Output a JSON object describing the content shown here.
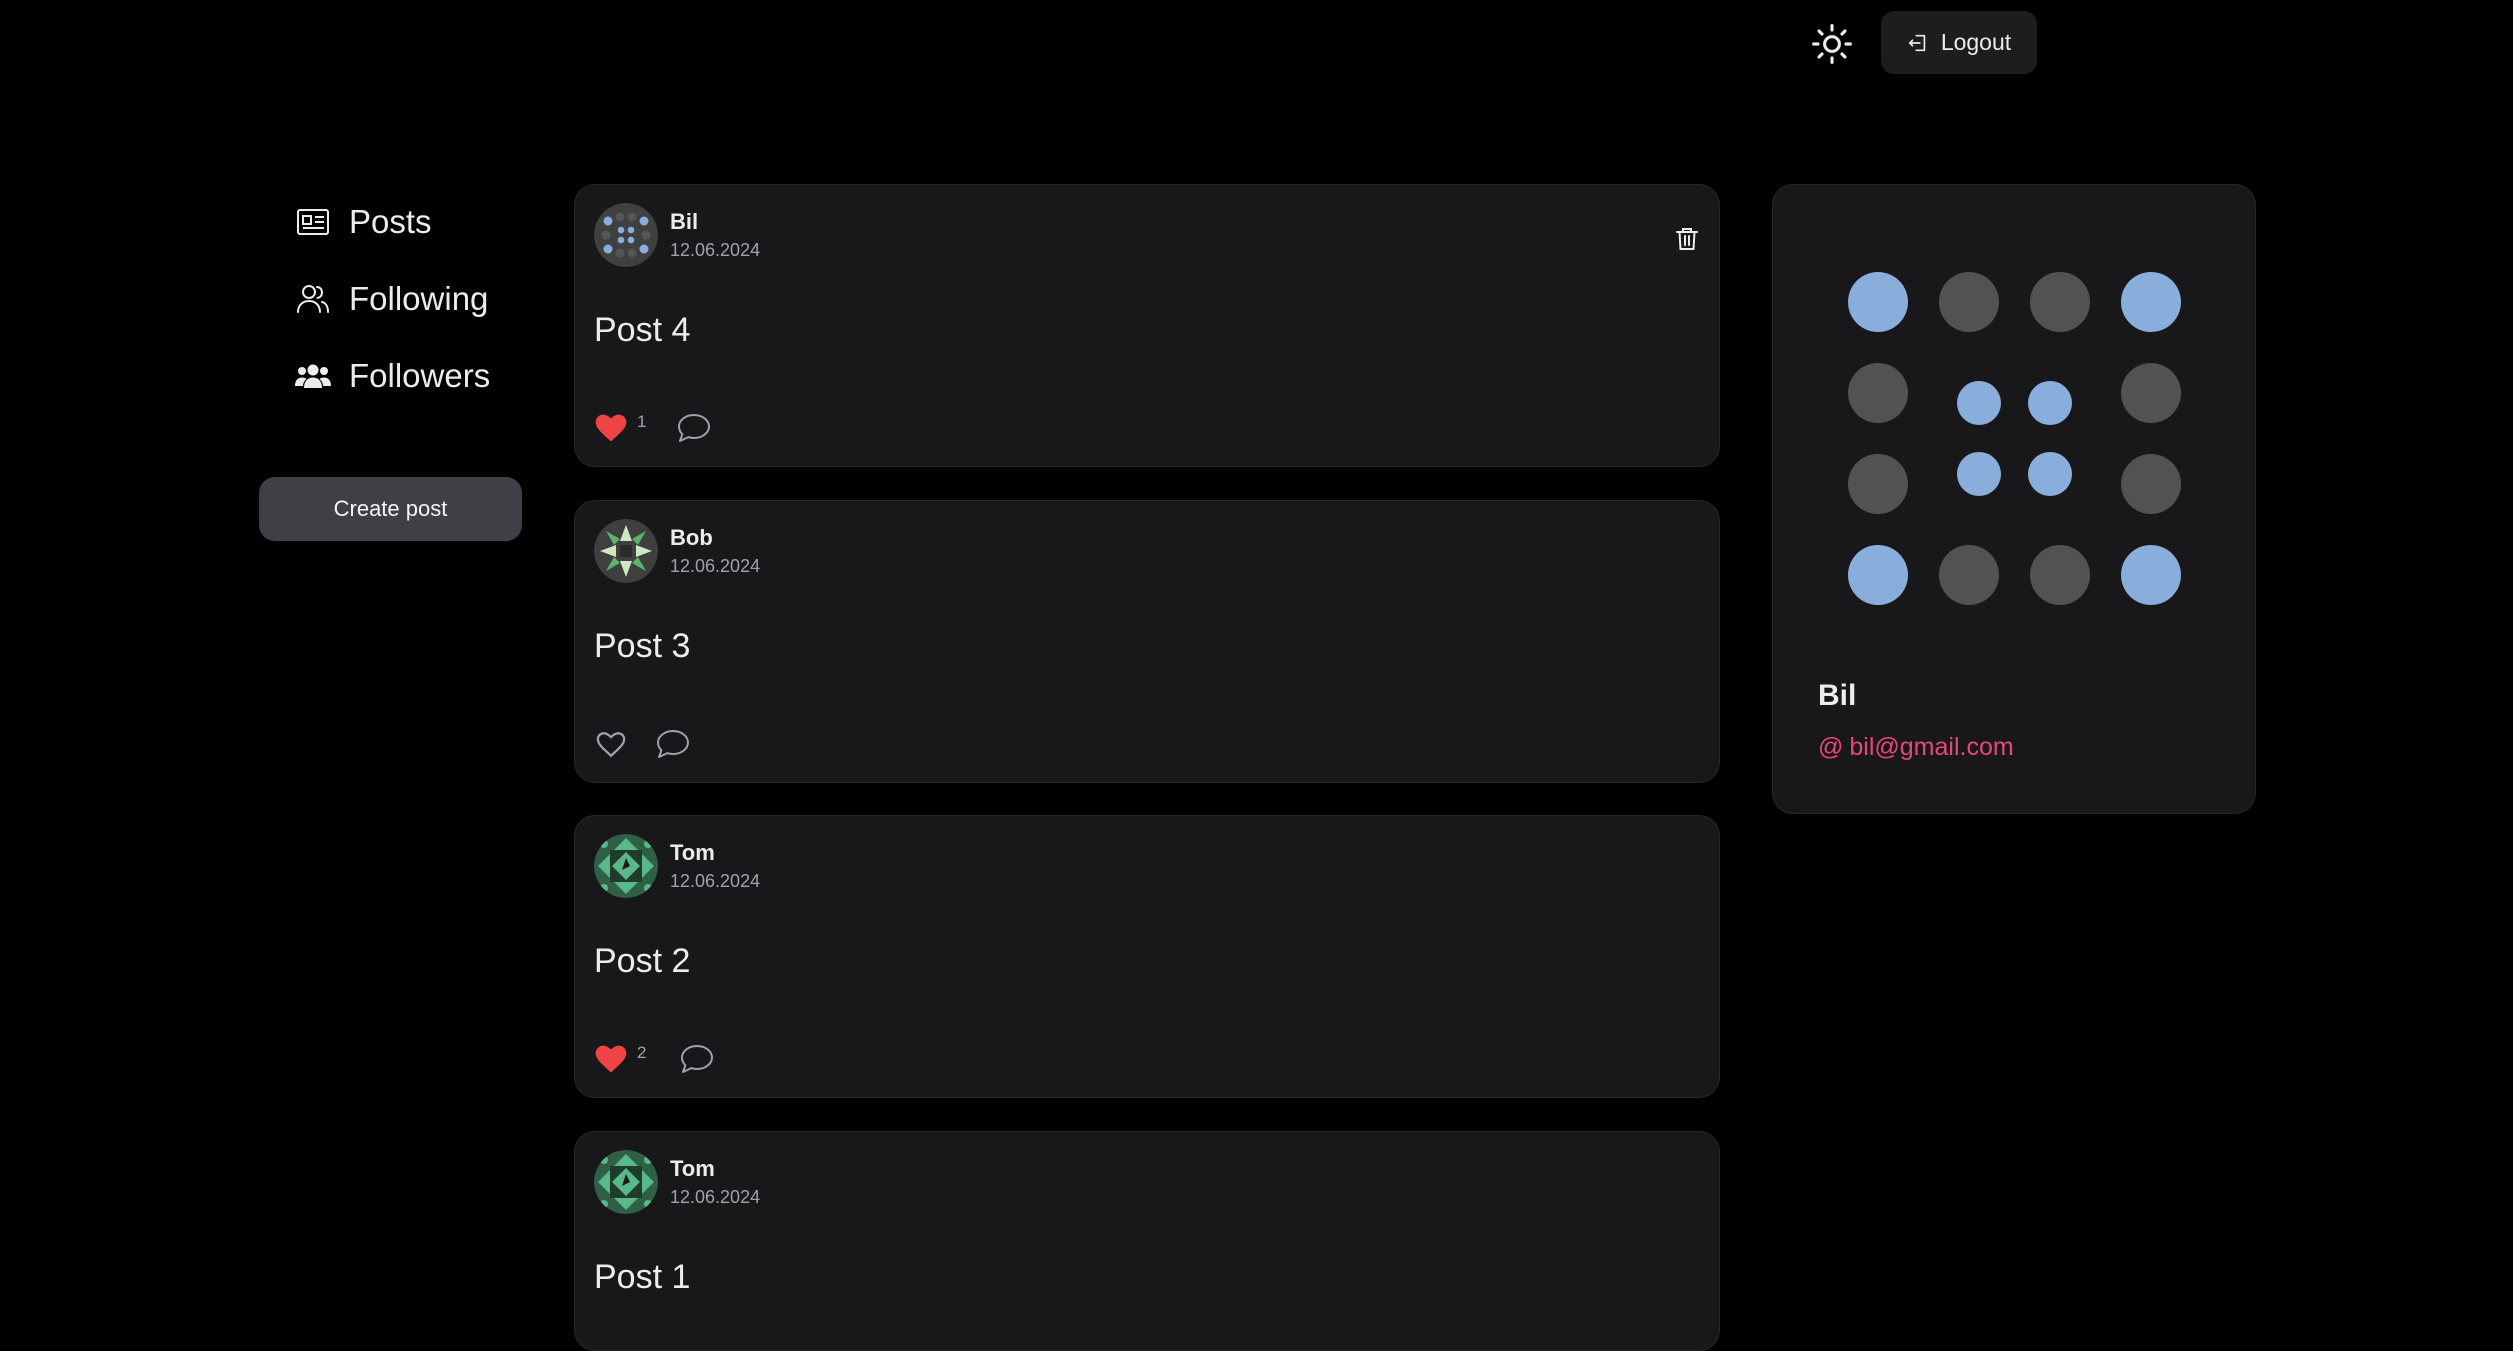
{
  "header": {
    "theme_icon": "sun-icon",
    "logout_label": "Logout",
    "logout_icon": "logout-icon"
  },
  "sidebar": {
    "items": [
      {
        "label": "Posts",
        "icon": "posts-icon"
      },
      {
        "label": "Following",
        "icon": "users-icon"
      },
      {
        "label": "Followers",
        "icon": "group-icon"
      }
    ],
    "create_post_label": "Create post"
  },
  "posts": [
    {
      "author": "Bil",
      "date": "12.06.2024",
      "content": "Post 4",
      "liked": true,
      "likes": "1",
      "deletable": true
    },
    {
      "author": "Bob",
      "date": "12.06.2024",
      "content": "Post 3",
      "liked": false,
      "likes": "",
      "deletable": false
    },
    {
      "author": "Tom",
      "date": "12.06.2024",
      "content": "Post 2",
      "liked": true,
      "likes": "2",
      "deletable": false
    },
    {
      "author": "Tom",
      "date": "12.06.2024",
      "content": "Post 1",
      "liked": false,
      "likes": "",
      "deletable": false
    }
  ],
  "profile": {
    "name": "Bil",
    "email": "bil@gmail.com",
    "email_icon": "at-icon"
  },
  "colors": {
    "background": "#000000",
    "card": "#18181b",
    "accent_pink": "#e8457b",
    "like_red": "#ef4444",
    "avatar_blue": "#8aaedc",
    "avatar_gray": "#525252"
  }
}
